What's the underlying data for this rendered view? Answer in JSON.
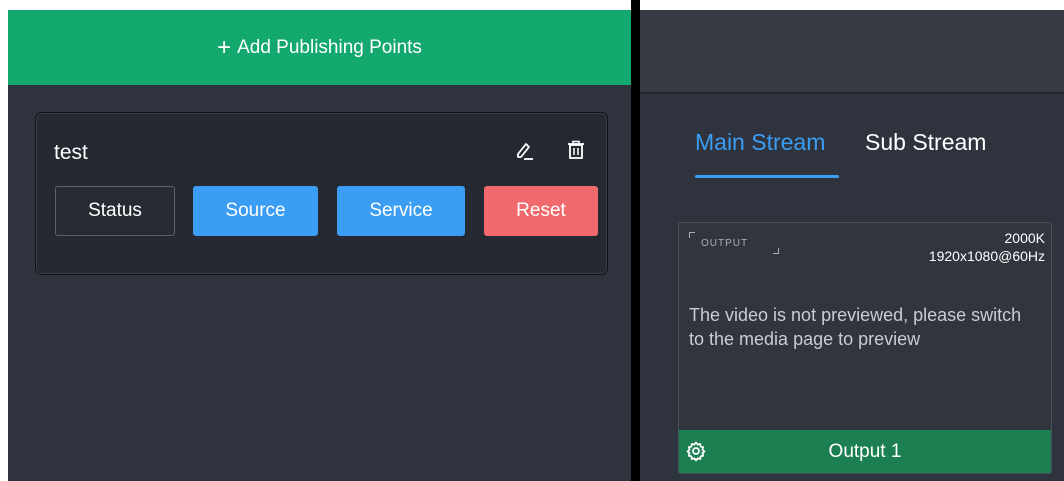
{
  "left": {
    "add_button_label": "Add Publishing Points",
    "card": {
      "title": "test",
      "edit_icon": "edit-icon",
      "delete_icon": "trash-icon",
      "buttons": {
        "status": "Status",
        "source": "Source",
        "service": "Service",
        "reset": "Reset"
      }
    }
  },
  "right": {
    "tabs": {
      "main": "Main Stream",
      "sub": "Sub Stream",
      "active": "main"
    },
    "output": {
      "tag": "OUTPUT",
      "bitrate": "2000K",
      "resolution": "1920x1080@60Hz",
      "message": "The video is not previewed, please switch to the media page to preview",
      "footer_label": "Output 1",
      "settings_icon": "gear-icon"
    }
  },
  "colors": {
    "accent_green": "#13a86e",
    "accent_blue": "#3c9df5",
    "danger_red": "#f06a6d",
    "footer_green": "#1c7f52",
    "panel_bg": "#2e333d"
  }
}
